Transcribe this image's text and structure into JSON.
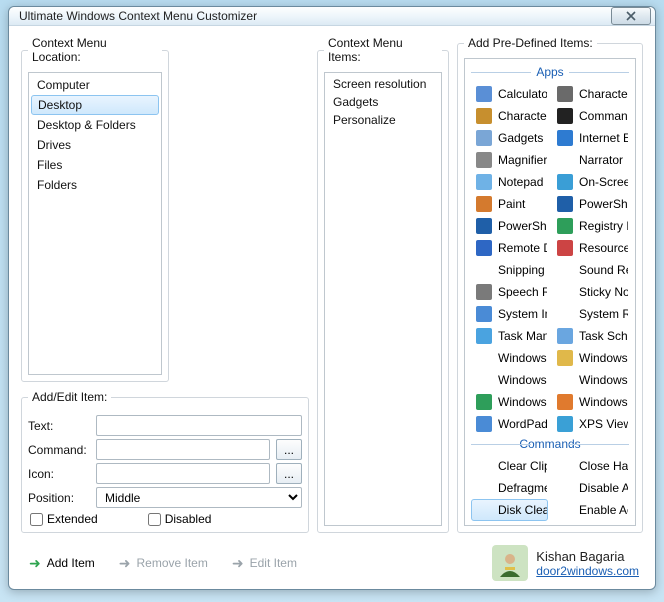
{
  "window": {
    "title": "Ultimate Windows Context Menu Customizer"
  },
  "panels": {
    "location_label": "Context Menu Location:",
    "items_label": "Context Menu Items:",
    "predef_label": "Add Pre-Defined Items:",
    "edit_label": "Add/Edit Item:"
  },
  "locations": [
    "Computer",
    "Desktop",
    "Desktop & Folders",
    "Drives",
    "Files",
    "Folders"
  ],
  "location_selected": 1,
  "context_items": [
    "Screen resolution",
    "Gadgets",
    "Personalize"
  ],
  "groups": {
    "apps_label": "Apps",
    "commands_label": "Commands"
  },
  "apps": [
    {
      "label": "Calculator",
      "c": "#5a8fd6"
    },
    {
      "label": "Character Editor",
      "c": "#6a6a6a"
    },
    {
      "label": "Character Map",
      "c": "#c78f2e"
    },
    {
      "label": "Command Prompt",
      "c": "#222"
    },
    {
      "label": "Gadgets",
      "c": "#7aa6d6"
    },
    {
      "label": "Internet Explorer",
      "c": "#2e7bd1"
    },
    {
      "label": "Magnifier",
      "c": "#888"
    },
    {
      "label": "Narrator",
      "c": ""
    },
    {
      "label": "Notepad",
      "c": "#6fb2e6"
    },
    {
      "label": "On-Screen Keyboard",
      "c": "#3a9ed6"
    },
    {
      "label": "Paint",
      "c": "#d47a2e"
    },
    {
      "label": "PowerShell",
      "c": "#1f5fa8"
    },
    {
      "label": "PowerShell ISE",
      "c": "#1f5fa8"
    },
    {
      "label": "Registry Editor",
      "c": "#2e9e5a"
    },
    {
      "label": "Remote Desktop",
      "c": "#2e67c4"
    },
    {
      "label": "Resource Monitor",
      "c": "#c44"
    },
    {
      "label": "Snipping Tool",
      "c": ""
    },
    {
      "label": "Sound Recorder",
      "c": ""
    },
    {
      "label": "Speech Recognition",
      "c": "#7a7a7a"
    },
    {
      "label": "Sticky Notes",
      "c": ""
    },
    {
      "label": "System Information",
      "c": "#4a8bd6"
    },
    {
      "label": "System Restore",
      "c": ""
    },
    {
      "label": "Task Manager",
      "c": "#4aa3e0"
    },
    {
      "label": "Task Scheduler",
      "c": "#6aa6e0"
    },
    {
      "label": "Windows DVD Maker",
      "c": ""
    },
    {
      "label": "Windows Explorer",
      "c": "#e0b84a"
    },
    {
      "label": "Windows Fax and Sc…",
      "c": ""
    },
    {
      "label": "Windows Journal",
      "c": ""
    },
    {
      "label": "Windows Media Cen…",
      "c": "#2e9e5a"
    },
    {
      "label": "Windows Media Player",
      "c": "#e07a2e"
    },
    {
      "label": "WordPad",
      "c": "#4a8bd6"
    },
    {
      "label": "XPS Viewer",
      "c": "#3aa0d6"
    }
  ],
  "commands": [
    {
      "label": "Clear Clipboard"
    },
    {
      "label": "Close Hanged Apps"
    },
    {
      "label": "Defragment"
    },
    {
      "label": "Disable Aero"
    },
    {
      "label": "Disk Cleanup"
    },
    {
      "label": "Enable Aero"
    }
  ],
  "command_selected": 4,
  "form": {
    "text_label": "Text:",
    "command_label": "Command:",
    "icon_label": "Icon:",
    "position_label": "Position:",
    "position_value": "Middle",
    "extended_label": "Extended",
    "disabled_label": "Disabled",
    "browse": "..."
  },
  "actions": {
    "add": "Add Item",
    "remove": "Remove Item",
    "edit": "Edit Item"
  },
  "credit": {
    "name": "Kishan Bagaria",
    "site": "door2windows.com"
  }
}
